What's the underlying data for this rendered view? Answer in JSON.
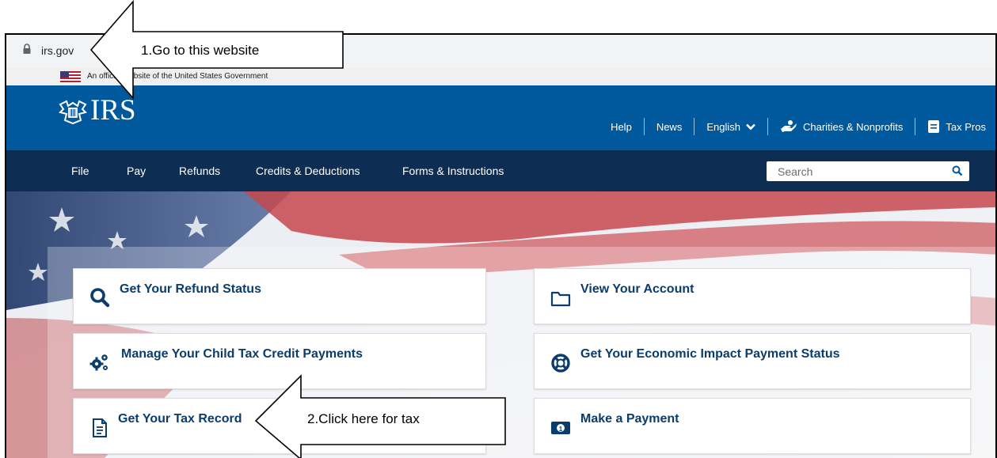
{
  "browser": {
    "url": "irs.gov"
  },
  "gov_banner": {
    "text": "An official website of the United States Government"
  },
  "header": {
    "logo_text": "IRS",
    "utility_links": [
      {
        "label": "Help"
      },
      {
        "label": "News"
      },
      {
        "label": "English"
      },
      {
        "label": "Charities & Nonprofits"
      },
      {
        "label": "Tax Pros"
      }
    ]
  },
  "nav": {
    "items": [
      {
        "label": "File"
      },
      {
        "label": "Pay"
      },
      {
        "label": "Refunds"
      },
      {
        "label": "Credits & Deductions"
      },
      {
        "label": "Forms & Instructions"
      }
    ],
    "search_placeholder": "Search"
  },
  "cards": [
    {
      "label": "Get Your Refund Status",
      "icon": "magnifier-icon"
    },
    {
      "label": "View Your Account",
      "icon": "folder-icon"
    },
    {
      "label": "Manage Your Child Tax Credit Payments",
      "icon": "gears-icon"
    },
    {
      "label": "Get Your Economic Impact Payment Status",
      "icon": "lifebuoy-icon"
    },
    {
      "label": "Get Your Tax Record",
      "icon": "document-icon"
    },
    {
      "label": "Make a Payment",
      "icon": "money-icon"
    }
  ],
  "annotations": [
    {
      "text": "1.Go to this website"
    },
    {
      "text": "2.Click here for tax"
    }
  ],
  "colors": {
    "header_blue": "#00599c",
    "nav_navy": "#0d2d53",
    "card_text": "#0a3d6e"
  }
}
